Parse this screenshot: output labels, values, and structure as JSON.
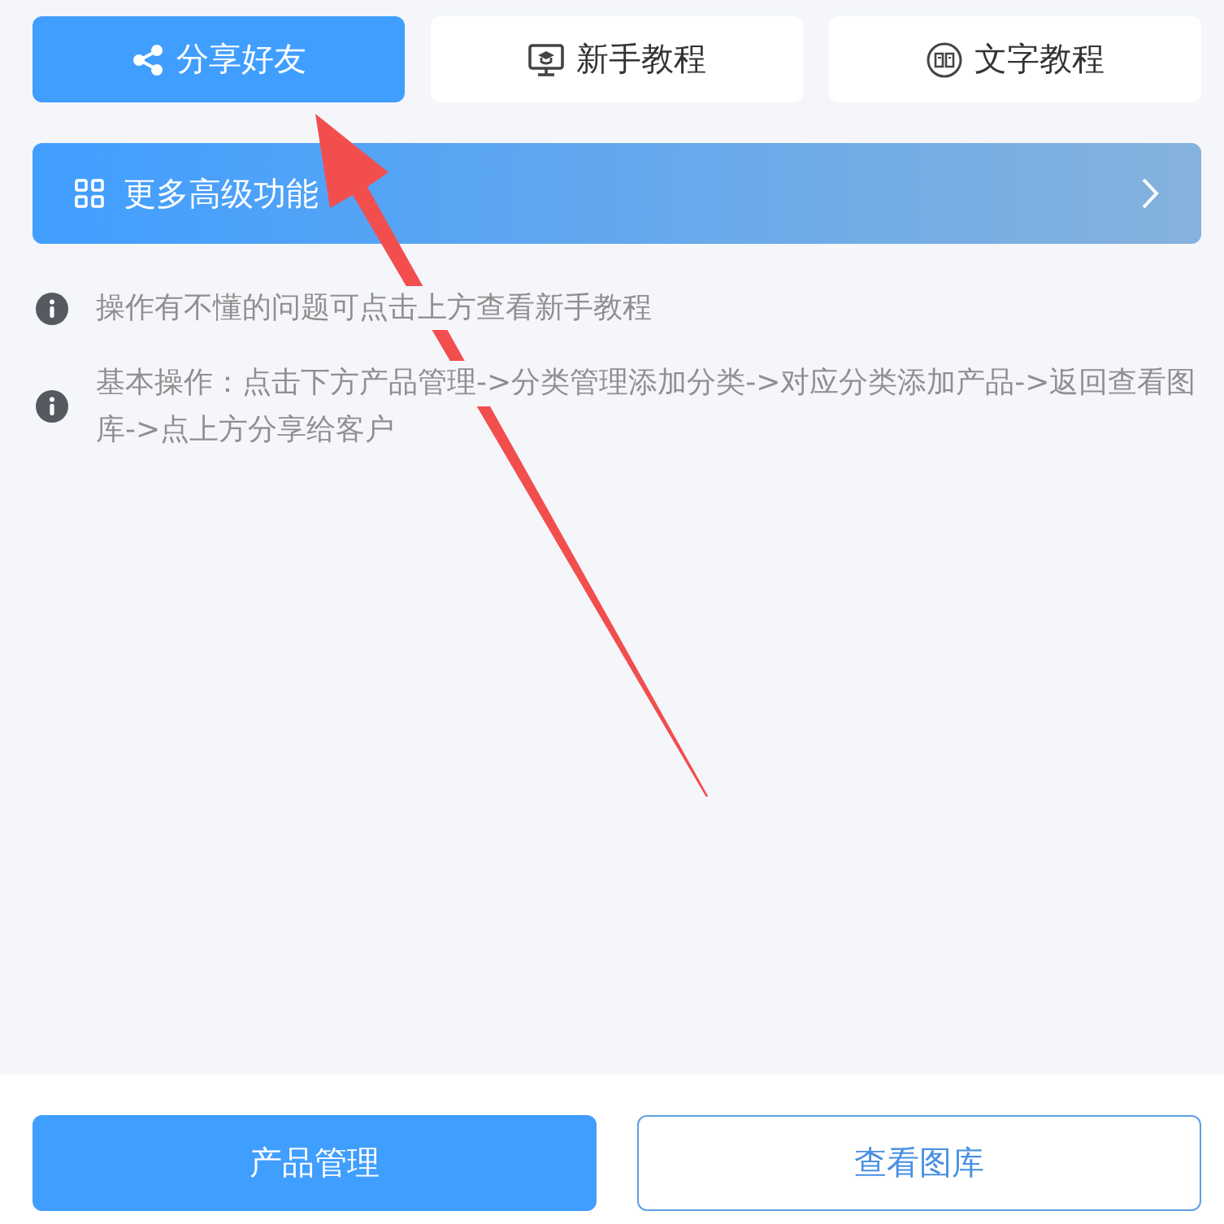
{
  "top_buttons": [
    {
      "label": "分享好友",
      "kind": "share",
      "primary": true
    },
    {
      "label": "新手教程",
      "kind": "video",
      "primary": false
    },
    {
      "label": "文字教程",
      "kind": "text",
      "primary": false
    }
  ],
  "banner": {
    "label": "更多高级功能"
  },
  "tips": [
    "操作有不懂的问题可点击上方查看新手教程",
    "基本操作：点击下方产品管理->分类管理添加分类->对应分类添加产品->返回查看图库->点上方分享给客户"
  ],
  "bottom_buttons": [
    {
      "label": "产品管理",
      "primary": true
    },
    {
      "label": "查看图库",
      "primary": false
    }
  ]
}
